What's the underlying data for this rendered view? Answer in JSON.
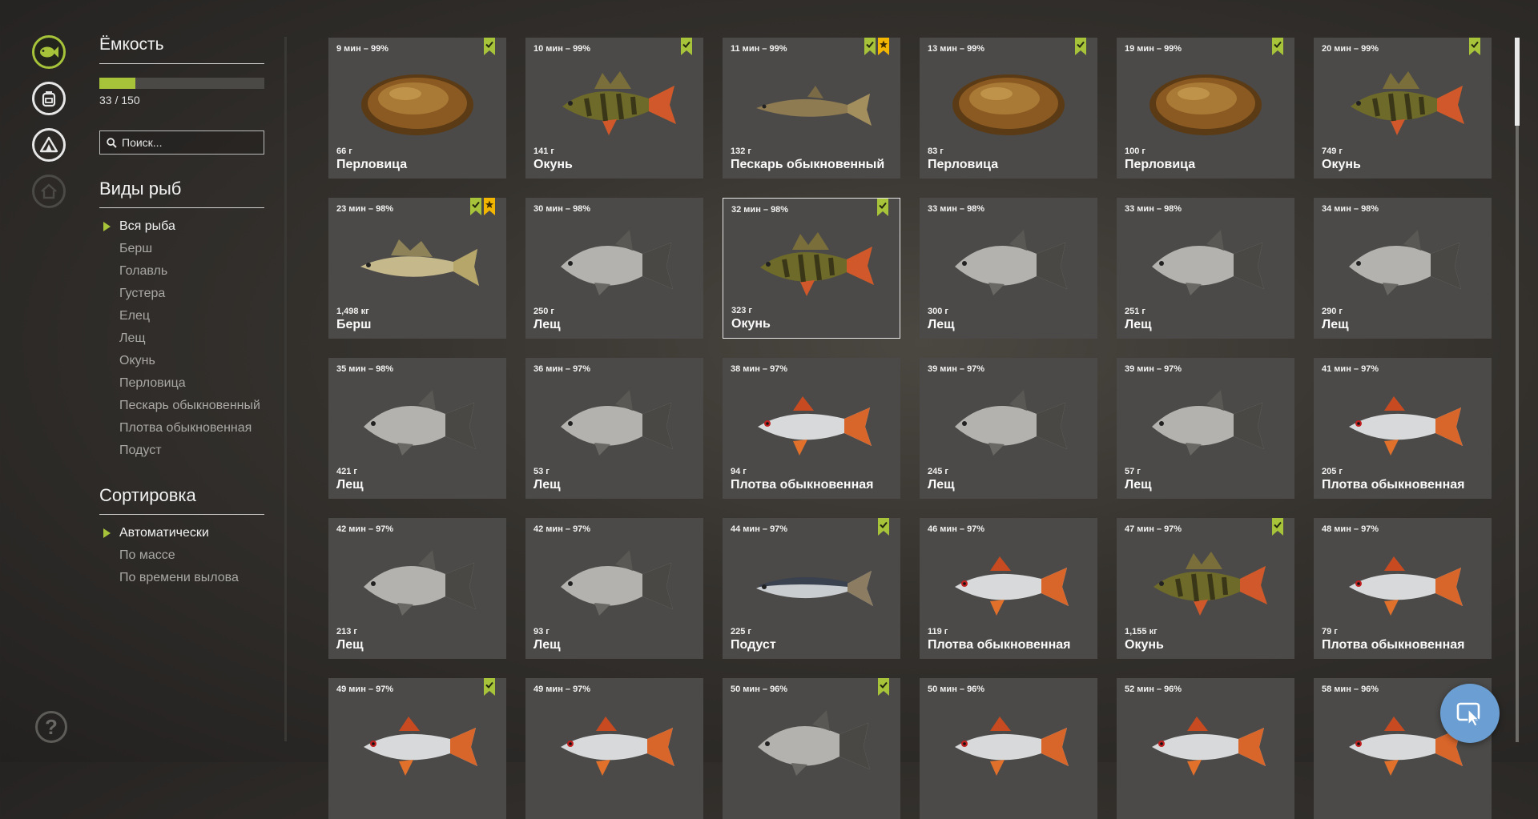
{
  "nav": {
    "icons": [
      {
        "name": "fish-icon",
        "state": "active"
      },
      {
        "name": "backpack-icon",
        "state": "normal"
      },
      {
        "name": "tent-icon",
        "state": "normal"
      },
      {
        "name": "home-icon",
        "state": "disabled"
      }
    ],
    "help_glyph": "?"
  },
  "capacity": {
    "title": "Ёмкость",
    "text": "33 / 150",
    "fraction": 0.22
  },
  "search": {
    "placeholder": "Поиск..."
  },
  "species": {
    "title": "Виды рыб",
    "selected": 0,
    "items": [
      "Вся рыба",
      "Берш",
      "Голавль",
      "Густера",
      "Елец",
      "Лещ",
      "Окунь",
      "Перловица",
      "Пескарь обыкновенный",
      "Плотва обыкновенная",
      "Подуст"
    ]
  },
  "sorting": {
    "title": "Сортировка",
    "selected": 0,
    "items": [
      "Автоматически",
      "По массе",
      "По времени вылова"
    ]
  },
  "colors": {
    "accent": "#a6c33a",
    "badge_star": "#f2b500",
    "fab": "#6b9fd3"
  },
  "fish": [
    {
      "time": "9 мин – 99%",
      "weight": "66 г",
      "name": "Перловица",
      "type": "mussel",
      "badges": [
        "check"
      ]
    },
    {
      "time": "10 мин – 99%",
      "weight": "141 г",
      "name": "Окунь",
      "type": "perch",
      "badges": [
        "check"
      ]
    },
    {
      "time": "11 мин – 99%",
      "weight": "132 г",
      "name": "Пескарь обыкновенный",
      "type": "gudgeon",
      "badges": [
        "check",
        "star"
      ]
    },
    {
      "time": "13 мин – 99%",
      "weight": "83 г",
      "name": "Перловица",
      "type": "mussel",
      "badges": [
        "check"
      ]
    },
    {
      "time": "19 мин – 99%",
      "weight": "100 г",
      "name": "Перловица",
      "type": "mussel",
      "badges": [
        "check"
      ]
    },
    {
      "time": "20 мин – 99%",
      "weight": "749 г",
      "name": "Окунь",
      "type": "perch",
      "badges": [
        "check"
      ]
    },
    {
      "time": "23 мин – 98%",
      "weight": "1,498 кг",
      "name": "Берш",
      "type": "zander",
      "badges": [
        "check",
        "star"
      ]
    },
    {
      "time": "30 мин – 98%",
      "weight": "250 г",
      "name": "Лещ",
      "type": "bream",
      "badges": []
    },
    {
      "time": "32 мин – 98%",
      "weight": "323 г",
      "name": "Окунь",
      "type": "perch",
      "badges": [
        "check"
      ],
      "highlight": true
    },
    {
      "time": "33 мин – 98%",
      "weight": "300 г",
      "name": "Лещ",
      "type": "bream",
      "badges": []
    },
    {
      "time": "33 мин – 98%",
      "weight": "251 г",
      "name": "Лещ",
      "type": "bream",
      "badges": []
    },
    {
      "time": "34 мин – 98%",
      "weight": "290 г",
      "name": "Лещ",
      "type": "bream",
      "badges": []
    },
    {
      "time": "35 мин – 98%",
      "weight": "421 г",
      "name": "Лещ",
      "type": "bream",
      "badges": []
    },
    {
      "time": "36 мин – 97%",
      "weight": "53 г",
      "name": "Лещ",
      "type": "bream",
      "badges": []
    },
    {
      "time": "38 мин – 97%",
      "weight": "94 г",
      "name": "Плотва обыкновенная",
      "type": "roach",
      "badges": []
    },
    {
      "time": "39 мин – 97%",
      "weight": "245 г",
      "name": "Лещ",
      "type": "bream",
      "badges": []
    },
    {
      "time": "39 мин – 97%",
      "weight": "57 г",
      "name": "Лещ",
      "type": "bream",
      "badges": []
    },
    {
      "time": "41 мин – 97%",
      "weight": "205 г",
      "name": "Плотва обыкновенная",
      "type": "roach",
      "badges": []
    },
    {
      "time": "42 мин – 97%",
      "weight": "213 г",
      "name": "Лещ",
      "type": "bream",
      "badges": []
    },
    {
      "time": "42 мин – 97%",
      "weight": "93 г",
      "name": "Лещ",
      "type": "bream",
      "badges": []
    },
    {
      "time": "44 мин – 97%",
      "weight": "225 г",
      "name": "Подуст",
      "type": "nase",
      "badges": [
        "check"
      ]
    },
    {
      "time": "46 мин – 97%",
      "weight": "119 г",
      "name": "Плотва обыкновенная",
      "type": "roach",
      "badges": []
    },
    {
      "time": "47 мин – 97%",
      "weight": "1,155 кг",
      "name": "Окунь",
      "type": "perch",
      "badges": [
        "check"
      ]
    },
    {
      "time": "48 мин – 97%",
      "weight": "79 г",
      "name": "Плотва обыкновенная",
      "type": "roach",
      "badges": []
    },
    {
      "time": "49 мин – 97%",
      "weight": "",
      "name": "",
      "type": "roach",
      "badges": [
        "check"
      ]
    },
    {
      "time": "49 мин – 97%",
      "weight": "",
      "name": "",
      "type": "roach",
      "badges": []
    },
    {
      "time": "50 мин – 96%",
      "weight": "",
      "name": "",
      "type": "bream",
      "badges": [
        "check"
      ]
    },
    {
      "time": "50 мин – 96%",
      "weight": "",
      "name": "",
      "type": "roach",
      "badges": []
    },
    {
      "time": "52 мин – 96%",
      "weight": "",
      "name": "",
      "type": "roach",
      "badges": []
    },
    {
      "time": "58 мин – 96%",
      "weight": "",
      "name": "",
      "type": "chub",
      "badges": []
    }
  ]
}
